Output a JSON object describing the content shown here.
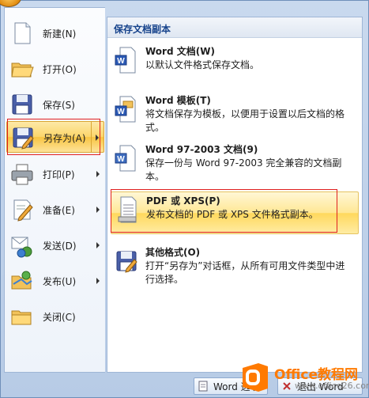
{
  "left_menu": {
    "items": [
      {
        "id": "new",
        "label": "新建(N)",
        "icon": "new-document-icon",
        "submenu": false
      },
      {
        "id": "open",
        "label": "打开(O)",
        "icon": "open-folder-icon",
        "submenu": false
      },
      {
        "id": "save",
        "label": "保存(S)",
        "icon": "save-icon",
        "submenu": false
      },
      {
        "id": "saveas",
        "label": "另存为(A)",
        "icon": "save-as-icon",
        "submenu": true,
        "active": true
      },
      {
        "id": "print",
        "label": "打印(P)",
        "icon": "printer-icon",
        "submenu": true
      },
      {
        "id": "prepare",
        "label": "准备(E)",
        "icon": "prepare-pen-icon",
        "submenu": true
      },
      {
        "id": "send",
        "label": "发送(D)",
        "icon": "send-mail-icon",
        "submenu": true
      },
      {
        "id": "publish",
        "label": "发布(U)",
        "icon": "publish-icon",
        "submenu": true
      },
      {
        "id": "close",
        "label": "关闭(C)",
        "icon": "close-folder-icon",
        "submenu": false
      }
    ]
  },
  "right_pane": {
    "header": "保存文档副本",
    "items": [
      {
        "title": "Word 文档(W)",
        "desc": "以默认文件格式保存文档。",
        "icon": "word-document-icon"
      },
      {
        "title": "Word 模板(T)",
        "desc": "将文档保存为模板，以便用于设置以后文档的格式。",
        "icon": "word-template-icon"
      },
      {
        "title": "Word 97-2003 文档(9)",
        "desc": "保存一份与 Word 97-2003 完全兼容的文档副本。",
        "icon": "word-legacy-icon"
      },
      {
        "title": "PDF 或 XPS(P)",
        "desc": "发布文档的 PDF 或 XPS 文件格式副本。",
        "icon": "pdf-xps-icon",
        "active": true
      },
      {
        "title": "其他格式(O)",
        "desc": "打开“另存为”对话框，从所有可用文件类型中进行选择。",
        "icon": "other-formats-icon"
      }
    ]
  },
  "bottom": {
    "options_label": "Word 选项",
    "exit_label": "退出 Word"
  },
  "watermark": {
    "title": "Office教程网",
    "url": "www.office26.com"
  },
  "colors": {
    "accent_red": "#e02020",
    "highlight": "#fbd56a",
    "watermark_orange": "#ff7a00"
  }
}
